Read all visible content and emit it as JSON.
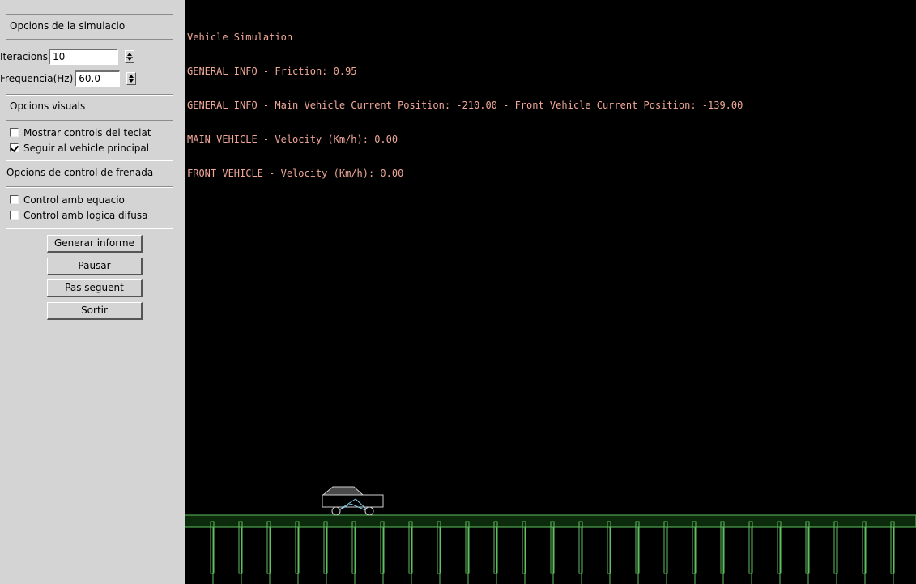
{
  "panel": {
    "sim_options_heading": "Opcions de la simulacio",
    "iterations_label": "Iteracions",
    "iterations_value": "10",
    "frequency_label": "Frequencia(Hz)",
    "frequency_value": "60.0",
    "visual_options_heading": "Opcions visuals",
    "show_keyboard_controls_label": "Mostrar controls del teclat",
    "show_keyboard_controls_checked": false,
    "follow_main_vehicle_label": "Seguir al vehicle principal",
    "follow_main_vehicle_checked": true,
    "brake_control_heading": "Opcions de control de frenada",
    "control_equation_label": "Control amb equacio",
    "control_equation_checked": false,
    "control_fuzzy_label": "Control amb logica difusa",
    "control_fuzzy_checked": false,
    "buttons": {
      "report": "Generar informe",
      "pause": "Pausar",
      "next_step": "Pas seguent",
      "exit": "Sortir"
    }
  },
  "simulation": {
    "info_lines": [
      "Vehicle Simulation",
      "GENERAL INFO - Friction: 0.95",
      "GENERAL INFO - Main Vehicle Current Position: -210.00 - Front Vehicle Current Position: -139.00",
      "MAIN VEHICLE - Velocity (Km/h): 0.00",
      "FRONT VEHICLE - Velocity (Km/h): 0.00"
    ],
    "colors": {
      "background": "#000000",
      "info_text": "#f0a898",
      "road": "#60c060",
      "vehicle_body": "#cfcfcf",
      "vehicle_roof": "#4a4a4a",
      "wheels": "#8ad0e8"
    }
  }
}
